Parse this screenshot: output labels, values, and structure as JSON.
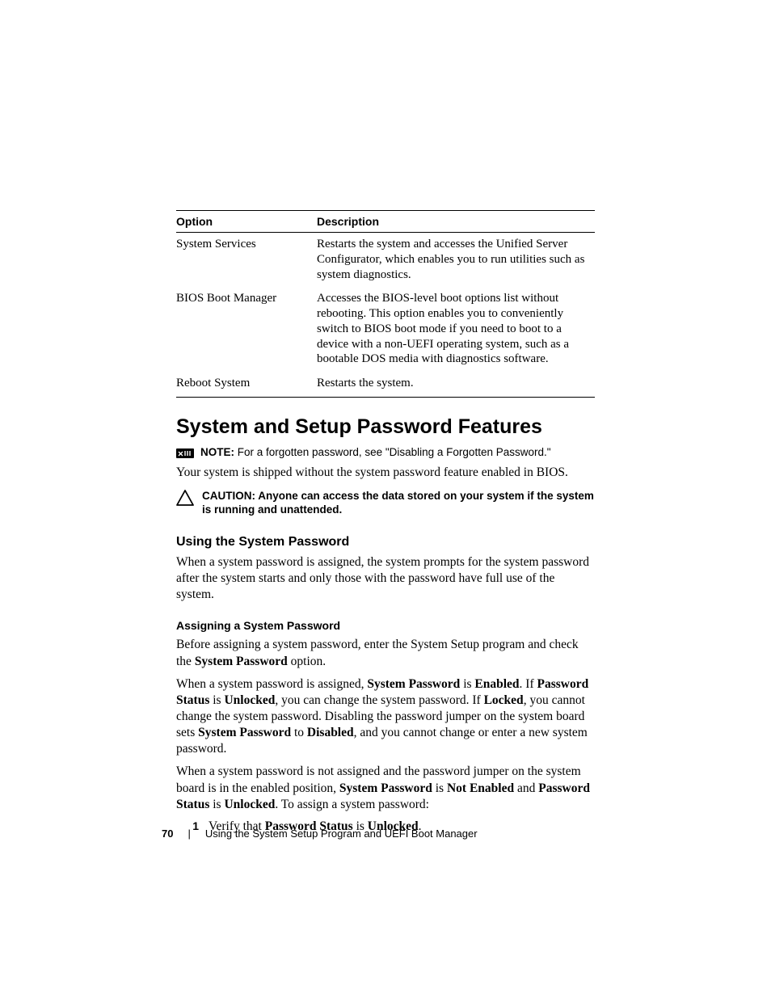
{
  "table": {
    "headers": {
      "option": "Option",
      "description": "Description"
    },
    "rows": [
      {
        "option": "System Services",
        "description": "Restarts the system and accesses the Unified Server Configurator, which enables you to run utilities such as system diagnostics."
      },
      {
        "option": "BIOS Boot Manager",
        "description": "Accesses the BIOS-level boot options list without rebooting. This option enables you to conveniently switch to BIOS boot mode if you need to boot to a device with a non-UEFI operating system, such as a bootable DOS media with diagnostics software."
      },
      {
        "option": "Reboot System",
        "description": "Restarts the system."
      }
    ]
  },
  "heading": "System and Setup Password Features",
  "note": {
    "lead": "NOTE:",
    "text": " For a forgotten password, see \"Disabling a Forgotten Password.\""
  },
  "intro": "Your system is shipped without the system password feature enabled in BIOS.",
  "caution": {
    "lead": "CAUTION: ",
    "text": "Anyone can access the data stored on your system if the system is running and unattended."
  },
  "sub1": {
    "title": "Using the System Password",
    "body": "When a system password is assigned, the system prompts for the system password after the system starts and only those with the password have full use of the system."
  },
  "sub2": {
    "title": "Assigning a System Password",
    "p1": {
      "a": "Before assigning a system password, enter the System Setup program and check the ",
      "b": "System Password",
      "c": " option."
    },
    "p2": {
      "a": "When a system password is assigned, ",
      "b1": "System Password",
      "c": " is ",
      "b2": "Enabled",
      "d": ". If ",
      "b3": "Password Status",
      "e": " is ",
      "b4": "Unlocked",
      "f": ", you can change the system password. If ",
      "b5": "Locked",
      "g": ", you cannot change the system password. Disabling the password jumper on the system board sets ",
      "b6": "System Password",
      "h": " to ",
      "b7": "Disabled",
      "i": ", and you cannot change or enter a new system password."
    },
    "p3": {
      "a": "When a system password is not assigned and the password jumper on the system board is in the enabled position, ",
      "b1": "System Password",
      "c": " is ",
      "b2": "Not Enabled",
      "d": " and ",
      "b3": "Password Status",
      "e": " is ",
      "b4": "Unlocked",
      "f": ". To assign a system password:"
    },
    "step1": {
      "num": "1",
      "a": "Verify that ",
      "b1": "Password Status",
      "c": " is ",
      "b2": "Unlocked",
      "d": "."
    }
  },
  "footer": {
    "page": "70",
    "sep": "|",
    "chapter": "Using the System Setup Program and UEFI Boot Manager"
  }
}
